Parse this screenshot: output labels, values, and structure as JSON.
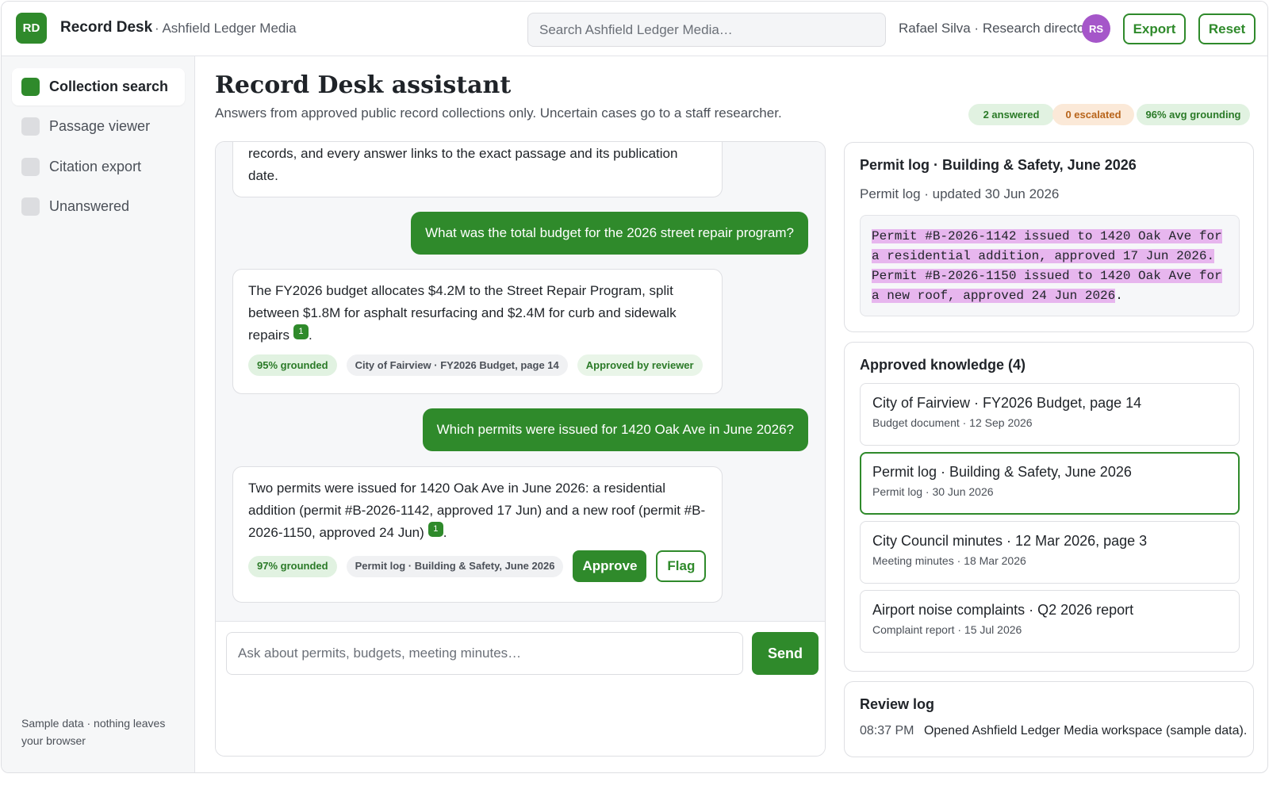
{
  "header": {
    "logo": "RD",
    "app_title": "Record Desk",
    "workspace": "· Ashfield Ledger Media",
    "search_placeholder": "Search Ashfield Ledger Media…",
    "user_line": "Rafael Silva · Research director",
    "avatar_initials": "RS",
    "export_label": "Export",
    "reset_label": "Reset"
  },
  "sidebar": {
    "items": [
      {
        "label": "Collection search",
        "active": true
      },
      {
        "label": "Passage viewer",
        "active": false
      },
      {
        "label": "Citation export",
        "active": false
      },
      {
        "label": "Unanswered",
        "active": false
      }
    ],
    "footer": "Sample data · nothing leaves your browser"
  },
  "main": {
    "title": "Record Desk assistant",
    "subtitle": "Answers from approved public record collections only. Uncertain cases go to a staff researcher.",
    "stats": {
      "answered": "2 answered",
      "escalated": "0 escalated",
      "grounding": "96% avg grounding"
    }
  },
  "chat": {
    "intro_partial": "records, and every answer links to the exact passage and its publication date.",
    "q1": "What was the total budget for the 2026 street repair program?",
    "a1": {
      "text": "The FY2026 budget allocates $4.2M to the Street Repair Program, split between $1.8M for asphalt resurfacing and $2.4M for curb and sidewalk repairs",
      "cite": "1",
      "end": ".",
      "grounded": "95% grounded",
      "source": "City of Fairview · FY2026 Budget, page 14",
      "status": "Approved by reviewer"
    },
    "q2": "Which permits were issued for 1420 Oak Ave in June 2026?",
    "a2": {
      "text": "Two permits were issued for 1420 Oak Ave in June 2026: a residential addition (permit #B-2026-1142, approved 17 Jun) and a new roof (permit #B-2026-1150, approved 24 Jun)",
      "cite": "1",
      "end": ".",
      "grounded": "97% grounded",
      "source": "Permit log · Building & Safety, June 2026",
      "approve_label": "Approve",
      "flag_label": "Flag"
    },
    "input_placeholder": "Ask about permits, budgets, meeting minutes…",
    "send_label": "Send"
  },
  "passage": {
    "title": "Permit log · Building & Safety, June 2026",
    "meta": "Permit log · updated 30 Jun 2026",
    "highlighted_text": "Permit #B-2026-1142 issued to 1420 Oak Ave for a residential addition, approved 17 Jun 2026. Permit #B-2026-1150 issued to 1420 Oak Ave for a new roof, approved 24 Jun 2026",
    "end": "."
  },
  "knowledge": {
    "title": "Approved knowledge (4)",
    "items": [
      {
        "name": "City of Fairview · FY2026 Budget, page 14",
        "meta": "Budget document · 12 Sep 2026",
        "selected": false
      },
      {
        "name": "Permit log · Building & Safety, June 2026",
        "meta": "Permit log · 30 Jun 2026",
        "selected": true
      },
      {
        "name": "City Council minutes · 12 Mar 2026, page 3",
        "meta": "Meeting minutes · 18 Mar 2026",
        "selected": false
      },
      {
        "name": "Airport noise complaints · Q2 2026 report",
        "meta": "Complaint report · 15 Jul 2026",
        "selected": false
      }
    ]
  },
  "review_log": {
    "title": "Review log",
    "entries": [
      {
        "time": "08:37 PM",
        "text": "Opened Ashfield Ledger Media workspace (sample data)."
      }
    ]
  },
  "colors": {
    "accent": "#2f8a2b",
    "avatar": "#a556c9",
    "highlight": "#e7b6ee",
    "escalated": "#b8641a"
  }
}
